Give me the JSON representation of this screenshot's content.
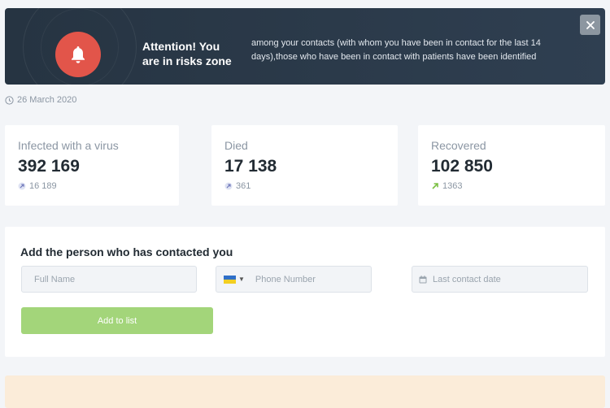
{
  "alert": {
    "title": "Attention! You are in risks zone",
    "message": "among your contacts (with whom you have been in contact for the last 14 days),those who have been in contact with patients have been identified",
    "close_symbol": "×",
    "bell_color": "#e2554a"
  },
  "date": "26 March 2020",
  "stats": {
    "infected": {
      "label": "Infected with a virus",
      "value": "392 169",
      "delta": "16 189",
      "delta_icon": "arrow-up-right-icon"
    },
    "died": {
      "label": "Died",
      "value": "17 138",
      "delta": "361",
      "delta_icon": "arrow-up-right-icon"
    },
    "recovered": {
      "label": "Recovered",
      "value": "102 850",
      "delta": "1363",
      "delta_icon": "arrow-up-right-icon",
      "delta_color": "#7bc043"
    }
  },
  "form": {
    "title": "Add the person who has contacted you",
    "full_name_placeholder": "Full Name",
    "phone_placeholder": "Phone Number",
    "date_placeholder": "Last contact date",
    "add_button": "Add to list"
  },
  "colors": {
    "accent_green": "#a3d57a",
    "alert_bg": "#263442",
    "warning_strip": "#fbecd9"
  }
}
